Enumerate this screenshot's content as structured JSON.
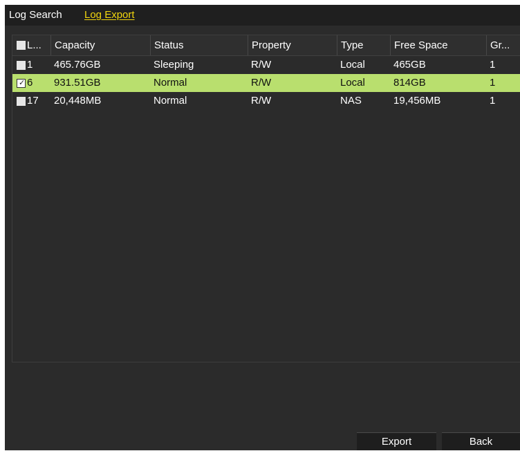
{
  "tabs": [
    {
      "label": "Log Search"
    },
    {
      "label": "Log Export"
    }
  ],
  "table": {
    "headers": [
      "L...",
      "Capacity",
      "Status",
      "Property",
      "Type",
      "Free Space",
      "Gr..."
    ],
    "rows": [
      {
        "label": "1",
        "capacity": "465.76GB",
        "status": "Sleeping",
        "property": "R/W",
        "type": "Local",
        "free_space": "465GB",
        "group": "1",
        "checked": false
      },
      {
        "label": "6",
        "capacity": "931.51GB",
        "status": "Normal",
        "property": "R/W",
        "type": "Local",
        "free_space": "814GB",
        "group": "1",
        "checked": true
      },
      {
        "label": "17",
        "capacity": "20,448MB",
        "status": "Normal",
        "property": "R/W",
        "type": "NAS",
        "free_space": "19,456MB",
        "group": "1",
        "checked": false
      }
    ]
  },
  "buttons": {
    "export_label": "Export",
    "back_label": "Back"
  },
  "colors": {
    "active_tab": "#f2d60e",
    "selected_row": "#b9df6e",
    "panel_bg": "#2b2b2b"
  }
}
